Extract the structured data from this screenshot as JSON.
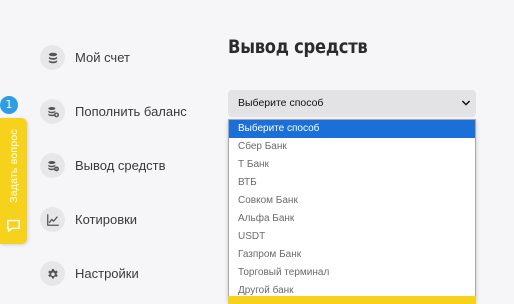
{
  "sidebar": {
    "items": [
      {
        "label": "Мой счет",
        "icon": "wallet-icon"
      },
      {
        "label": "Пополнить баланс",
        "icon": "coins-plus-icon"
      },
      {
        "label": "Вывод средств",
        "icon": "coins-minus-icon"
      },
      {
        "label": "Котировки",
        "icon": "chart-line-icon"
      },
      {
        "label": "Настройки",
        "icon": "gear-icon"
      }
    ]
  },
  "ask_widget": {
    "label": "Задать вопрос",
    "badge_count": "1",
    "icon": "chat-icon",
    "color": "#f7d21c"
  },
  "main": {
    "title": "Вывод средств",
    "method_select": {
      "selected_label": "Выберите способ",
      "options": [
        "Выберите способ",
        "Сбер Банк",
        "Т Банк",
        "ВТБ",
        "Совком Банк",
        "Альфа Банк",
        "USDT",
        "Газпром Банк",
        "Торговый терминал",
        "Другой банк"
      ],
      "highlighted_index": 0,
      "highlight_color": "#1a6fd8"
    }
  }
}
